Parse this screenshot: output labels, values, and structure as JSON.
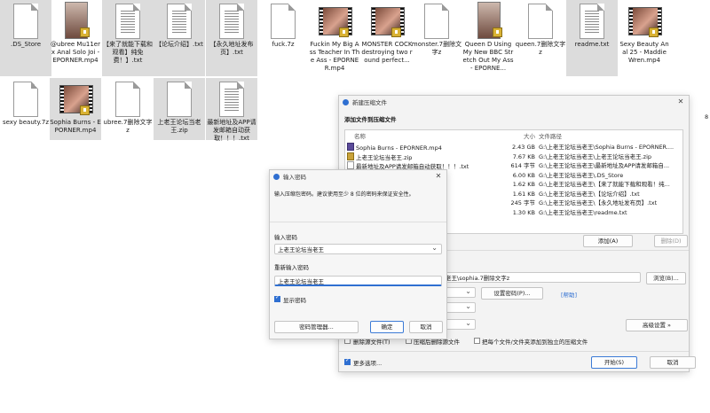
{
  "explorer": {
    "files": [
      {
        "name": ".DS_Store",
        "type": "doc",
        "selected": true
      },
      {
        "name": "@ubree Mu11erx Anal Solo Joi - EPORNER.mp4",
        "type": "portrait",
        "selected": false
      },
      {
        "name": "【来了就能下载和观看】纯免费！】.txt",
        "type": "doc",
        "selected": true
      },
      {
        "name": "【论坛介绍】.txt",
        "type": "doc",
        "selected": true
      },
      {
        "name": "【永久地址发布页】.txt",
        "type": "doc",
        "selected": true
      },
      {
        "name": "fuck.7z",
        "type": "doc",
        "selected": false
      },
      {
        "name": "Fuckin My Big Ass Teacher In The Ass - EPORNER.mp4",
        "type": "video",
        "selected": false
      },
      {
        "name": "MONSTER COCK destroying two round perfect...",
        "type": "video",
        "selected": false
      },
      {
        "name": "monster.7删除文字z",
        "type": "doc",
        "selected": false
      },
      {
        "name": "Queen D Using My New BBC Stretch Out My Ass - EPORNE...",
        "type": "portrait",
        "selected": false
      },
      {
        "name": "queen.7删除文字z",
        "type": "doc",
        "selected": false
      },
      {
        "name": "readme.txt",
        "type": "doc",
        "selected": true
      },
      {
        "name": "Sexy Beauty Anal 25 - Maddie Wren.mp4",
        "type": "video",
        "selected": false
      },
      {
        "name": "sexy beauty.7z",
        "type": "doc",
        "selected": false
      },
      {
        "name": "Sophia Burns - EPORNER.mp4",
        "type": "video",
        "selected": true
      },
      {
        "name": "ubree.7删除文字z",
        "type": "doc",
        "selected": false
      },
      {
        "name": "上老王论坛当老王.zip",
        "type": "doc",
        "selected": true
      },
      {
        "name": "最新地址及APP请发邮箱自动获取！！！.txt",
        "type": "doc",
        "selected": true
      }
    ]
  },
  "archive_dialog": {
    "title": "新建压缩文件",
    "section_title": "添加文件到压缩文件",
    "columns": {
      "name": "名称",
      "size": "大小",
      "path": "文件路径"
    },
    "rows": [
      {
        "name": "Sophia Burns - EPORNER.mp4",
        "size": "2.43 GB",
        "path": "G:\\上老王论坛当老王\\Sophia Burns - EPORNER....",
        "icon": "vid"
      },
      {
        "name": "上老王论坛当老王.zip",
        "size": "7.67 KB",
        "path": "G:\\上老王论坛当老王\\上老王论坛当老王.zip",
        "icon": "zip"
      },
      {
        "name": "最新地址及APP请发邮箱自动获取！！！.txt",
        "size": "614 字节",
        "path": "G:\\上老王论坛当老王\\最新地址及APP请发邮箱自...",
        "icon": "doc"
      },
      {
        "name": "",
        "size": "6.00 KB",
        "path": "G:\\上老王论坛当老王\\.DS_Store",
        "icon": "doc"
      },
      {
        "name": "txt",
        "size": "1.62 KB",
        "path": "G:\\上老王论坛当老王\\【来了就能下载和观看！纯...",
        "icon": "doc"
      },
      {
        "name": "",
        "size": "1.61 KB",
        "path": "G:\\上老王论坛当老王\\【论坛介绍】.txt",
        "icon": "doc"
      },
      {
        "name": "",
        "size": "245 字节",
        "path": "G:\\上老王论坛当老王\\【永久地址发布页】.txt",
        "icon": "doc"
      },
      {
        "name": "",
        "size": "1.30 KB",
        "path": "G:\\上老王论坛当老王\\readme.txt",
        "icon": "doc"
      }
    ],
    "add_btn": "添加(A)",
    "delete_btn": "删除(D)",
    "archive_path": "老王\\sophia.7删除文字z",
    "browse_btn": "浏览(B)...",
    "set_password_btn": "设置密码(P)...",
    "help_link": "[帮助]",
    "advanced_btn": "高级设置 »",
    "opt_delete_after": "删除原文件(T)",
    "opt_delete_after_prefix": "删除源文件(T)",
    "opt_compress_delete": "压缩后删除源文件",
    "opt_separate": "把每个文件/文件夹添加到独立的压缩文件",
    "more_options": "更多选项...",
    "start_btn": "开始(S)",
    "cancel_btn": "取消"
  },
  "password_dialog": {
    "title": "输入密码",
    "hint": "输入压缩包密码。建议使用至少 8 位的密码来保证安全性。",
    "label_pw": "输入密码",
    "pw_value": "上老王论坛当老王",
    "label_confirm": "重新输入密码",
    "confirm_value": "上老王论坛当老王",
    "show_password": "显示密码",
    "manager_btn": "密码管理器...",
    "ok_btn": "确定",
    "cancel_btn": "取消"
  },
  "edge_chars": {
    "c1": "8",
    "c2": "8"
  }
}
